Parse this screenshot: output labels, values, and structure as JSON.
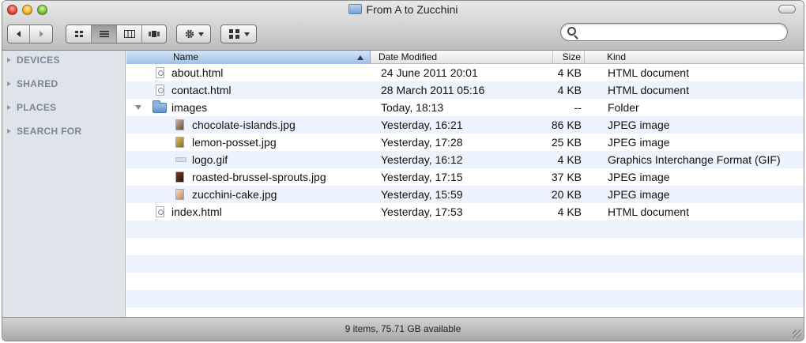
{
  "window": {
    "title": "From A to Zucchini"
  },
  "toolbar": {
    "nav_icons": [
      "back-icon",
      "forward-icon"
    ],
    "view_icons": [
      "icon-view-icon",
      "list-view-icon",
      "column-view-icon",
      "coverflow-view-icon"
    ],
    "active_view": "list-view-icon",
    "action_icon": "gear-icon",
    "arrange_icon": "arrange-icon"
  },
  "search": {
    "value": "",
    "placeholder": ""
  },
  "sidebar": {
    "sections": [
      {
        "label": "DEVICES"
      },
      {
        "label": "SHARED"
      },
      {
        "label": "PLACES"
      },
      {
        "label": "SEARCH FOR"
      }
    ]
  },
  "columns": {
    "name": "Name",
    "date": "Date Modified",
    "size": "Size",
    "kind": "Kind"
  },
  "files": [
    {
      "name": "about.html",
      "date": "24 June 2011 20:01",
      "size": "4 KB",
      "kind": "HTML document"
    },
    {
      "name": "contact.html",
      "date": "28 March 2011 05:16",
      "size": "4 KB",
      "kind": "HTML document"
    },
    {
      "name": "images",
      "date": "Today, 18:13",
      "size": "--",
      "kind": "Folder"
    },
    {
      "name": "chocolate-islands.jpg",
      "date": "Yesterday, 16:21",
      "size": "86 KB",
      "kind": "JPEG image"
    },
    {
      "name": "lemon-posset.jpg",
      "date": "Yesterday, 17:28",
      "size": "25 KB",
      "kind": "JPEG image"
    },
    {
      "name": "logo.gif",
      "date": "Yesterday, 16:12",
      "size": "4 KB",
      "kind": "Graphics Interchange Format (GIF)"
    },
    {
      "name": "roasted-brussel-sprouts.jpg",
      "date": "Yesterday, 17:15",
      "size": "37 KB",
      "kind": "JPEG image"
    },
    {
      "name": "zucchini-cake.jpg",
      "date": "Yesterday, 15:59",
      "size": "20 KB",
      "kind": "JPEG image"
    },
    {
      "name": "index.html",
      "date": "Yesterday, 17:53",
      "size": "4 KB",
      "kind": "HTML document"
    }
  ],
  "status": {
    "text": "9 items, 75.71 GB available"
  },
  "colors": {
    "sidebar_bg": "#dee4ea",
    "row_alt": "#edf3fe",
    "header_sorted": "#9fc0e6"
  }
}
